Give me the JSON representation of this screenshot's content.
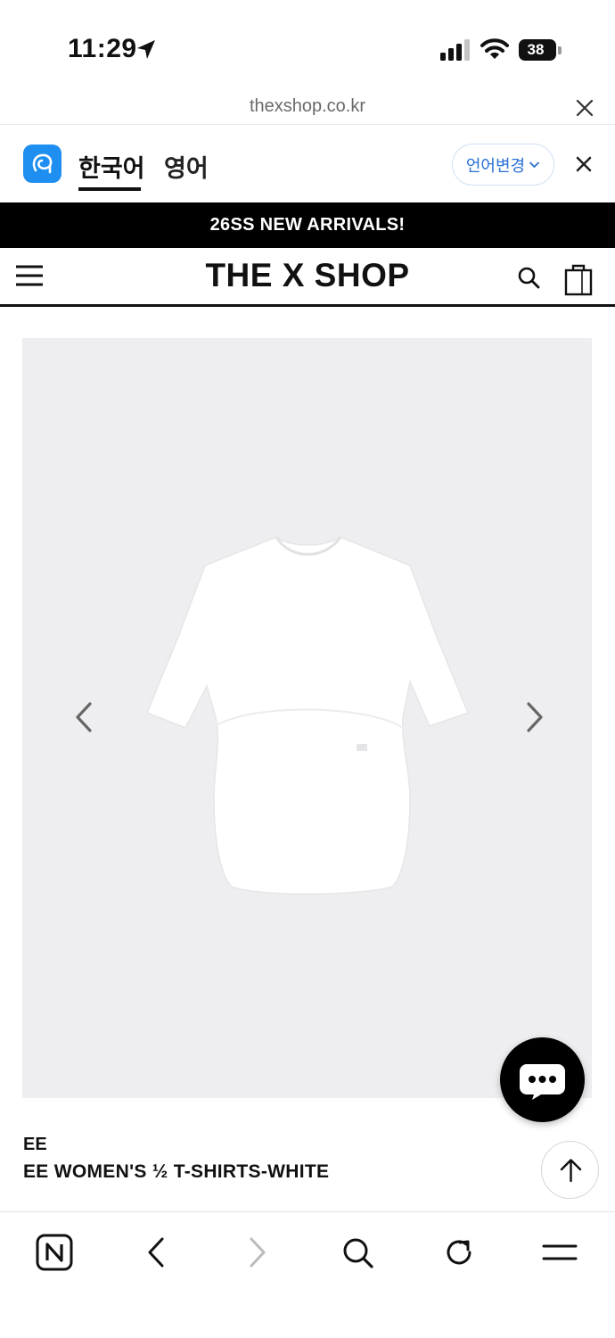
{
  "status_bar": {
    "time": "11:29",
    "battery": "38"
  },
  "browser": {
    "url": "thexshop.co.kr"
  },
  "translate_bar": {
    "lang_korean": "한국어",
    "lang_english": "영어",
    "change_language": "언어변경"
  },
  "promo": {
    "text": "26SS NEW ARRIVALS!"
  },
  "header": {
    "logo": "THE X SHOP"
  },
  "product": {
    "brand": "EE",
    "name": "EE WOMEN'S ½ T-SHIRTS-WHITE"
  },
  "icons": {
    "status": [
      "location-arrow-icon",
      "signal-icon",
      "wifi-icon",
      "battery-icon"
    ],
    "header": [
      "menu-icon",
      "search-icon",
      "cart-icon"
    ],
    "toolbar": [
      "naver-home-icon",
      "back-icon",
      "forward-icon",
      "search-icon",
      "refresh-icon",
      "menu-icon"
    ]
  },
  "colors": {
    "translate_accent": "#1e8ff0",
    "banner_bg": "#000000",
    "image_bg": "#eeeef0"
  }
}
